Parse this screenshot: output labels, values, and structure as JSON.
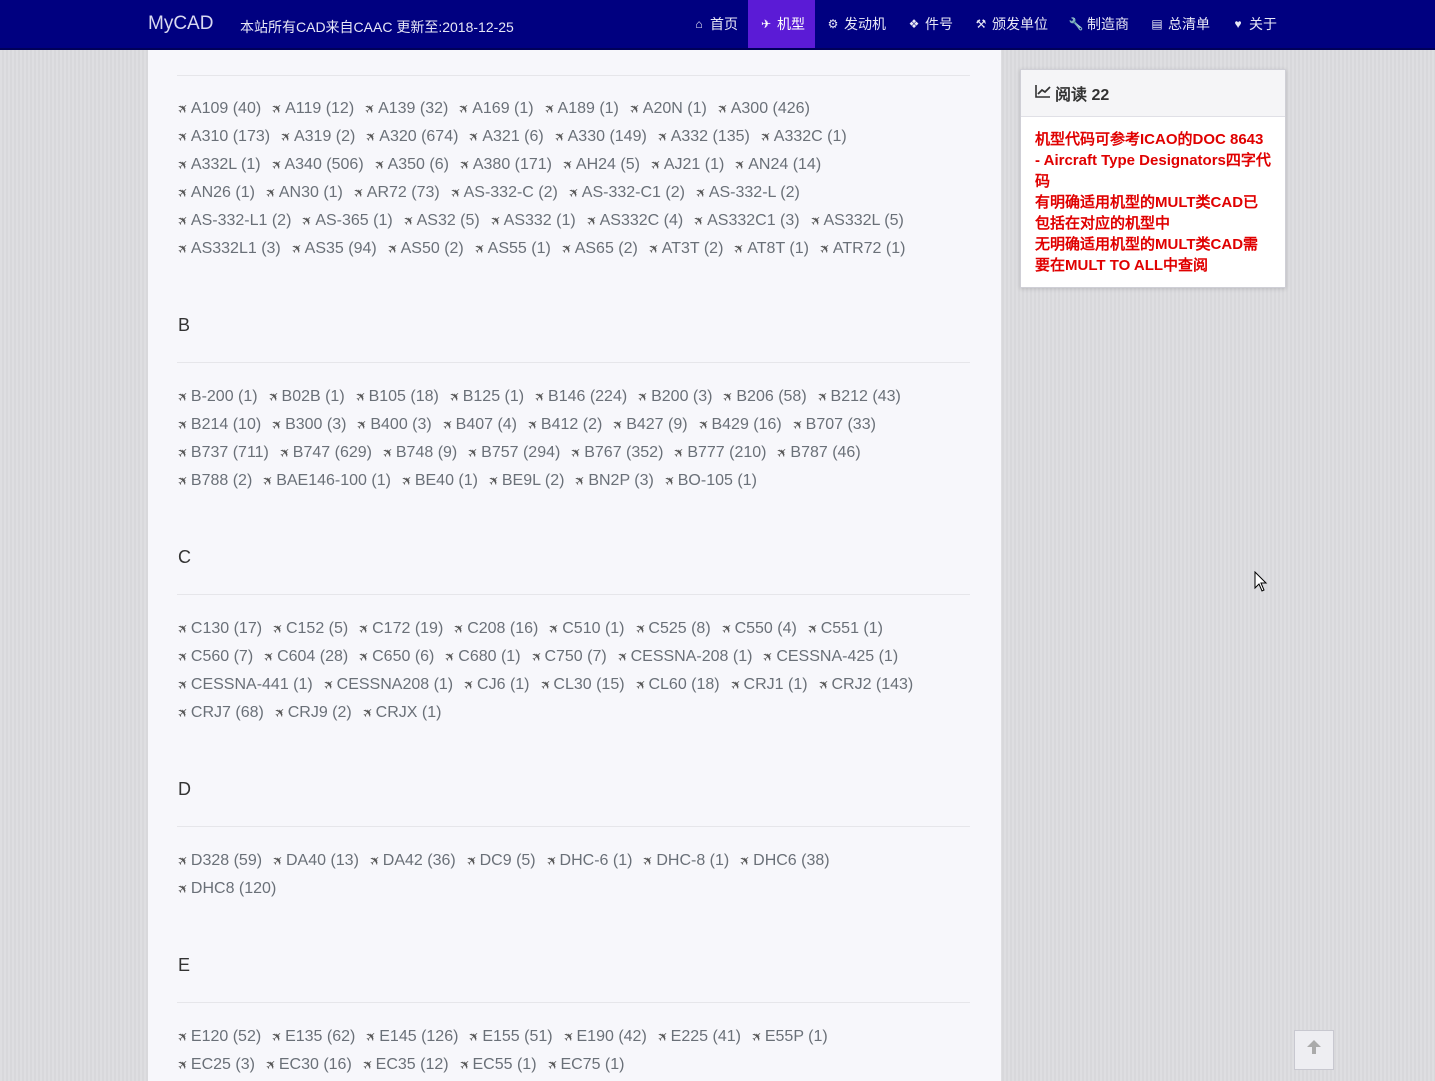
{
  "brand": "MyCAD",
  "subtitle": "本站所有CAD来自CAAC 更新至:2018-12-25",
  "nav": [
    {
      "label": "首页",
      "icon": "home-icon",
      "glyph": "⌂"
    },
    {
      "label": "机型",
      "icon": "plane-icon",
      "glyph": "✈"
    },
    {
      "label": "发动机",
      "icon": "cogs-icon",
      "glyph": "⚙"
    },
    {
      "label": "件号",
      "icon": "cubes-icon",
      "glyph": "❖"
    },
    {
      "label": "颁发单位",
      "icon": "gavel-icon",
      "glyph": "⚒"
    },
    {
      "label": "制造商",
      "icon": "wrench-icon",
      "glyph": "🔧"
    },
    {
      "label": "总清单",
      "icon": "list-icon",
      "glyph": "▤"
    },
    {
      "label": "关于",
      "icon": "heart-icon",
      "glyph": "♥"
    }
  ],
  "active_nav": 1,
  "sections": [
    {
      "letter": "",
      "rows": [
        [
          "A109 (40)",
          "A119 (12)",
          "A139 (32)",
          "A169 (1)",
          "A189 (1)",
          "A20N (1)",
          "A300 (426)"
        ],
        [
          "A310 (173)",
          "A319 (2)",
          "A320 (674)",
          "A321 (6)",
          "A330 (149)",
          "A332 (135)",
          "A332C (1)"
        ],
        [
          "A332L (1)",
          "A340 (506)",
          "A350 (6)",
          "A380 (171)",
          "AH24 (5)",
          "AJ21 (1)",
          "AN24 (14)"
        ],
        [
          "AN26 (1)",
          "AN30 (1)",
          "AR72 (73)",
          "AS-332-C (2)",
          "AS-332-C1 (2)",
          "AS-332-L (2)"
        ],
        [
          "AS-332-L1 (2)",
          "AS-365 (1)",
          "AS32 (5)",
          "AS332 (1)",
          "AS332C (4)",
          "AS332C1 (3)",
          "AS332L (5)"
        ],
        [
          "AS332L1 (3)",
          "AS35 (94)",
          "AS50 (2)",
          "AS55 (1)",
          "AS65 (2)",
          "AT3T (2)",
          "AT8T (1)",
          "ATR72 (1)"
        ]
      ]
    },
    {
      "letter": "B",
      "rows": [
        [
          "B-200 (1)",
          "B02B (1)",
          "B105 (18)",
          "B125 (1)",
          "B146 (224)",
          "B200 (3)",
          "B206 (58)",
          "B212 (43)"
        ],
        [
          "B214 (10)",
          "B300 (3)",
          "B400 (3)",
          "B407 (4)",
          "B412 (2)",
          "B427 (9)",
          "B429 (16)",
          "B707 (33)"
        ],
        [
          "B737 (711)",
          "B747 (629)",
          "B748 (9)",
          "B757 (294)",
          "B767 (352)",
          "B777 (210)",
          "B787 (46)"
        ],
        [
          "B788 (2)",
          "BAE146-100 (1)",
          "BE40 (1)",
          "BE9L (2)",
          "BN2P (3)",
          "BO-105 (1)"
        ]
      ]
    },
    {
      "letter": "C",
      "rows": [
        [
          "C130 (17)",
          "C152 (5)",
          "C172 (19)",
          "C208 (16)",
          "C510 (1)",
          "C525 (8)",
          "C550 (4)",
          "C551 (1)"
        ],
        [
          "C560 (7)",
          "C604 (28)",
          "C650 (6)",
          "C680 (1)",
          "C750 (7)",
          "CESSNA-208 (1)",
          "CESSNA-425 (1)"
        ],
        [
          "CESSNA-441 (1)",
          "CESSNA208 (1)",
          "CJ6 (1)",
          "CL30 (15)",
          "CL60 (18)",
          "CRJ1 (1)",
          "CRJ2 (143)"
        ],
        [
          "CRJ7 (68)",
          "CRJ9 (2)",
          "CRJX (1)"
        ]
      ]
    },
    {
      "letter": "D",
      "rows": [
        [
          "D328 (59)",
          "DA40 (13)",
          "DA42 (36)",
          "DC9 (5)",
          "DHC-6 (1)",
          "DHC-8 (1)",
          "DHC6 (38)"
        ],
        [
          "DHC8 (120)"
        ]
      ]
    },
    {
      "letter": "E",
      "rows": [
        [
          "E120 (52)",
          "E135 (62)",
          "E145 (126)",
          "E155 (51)",
          "E190 (42)",
          "E225 (41)",
          "E55P (1)"
        ],
        [
          "EC25 (3)",
          "EC30 (16)",
          "EC35 (12)",
          "EC55 (1)",
          "EC75 (1)"
        ]
      ]
    }
  ],
  "side": {
    "title": "阅读 22",
    "lines": [
      "机型代码可参考ICAO的DOC 8643 - Aircraft Type Designators四字代码",
      "有明确适用机型的MULT类CAD已包括在对应的机型中",
      "无明确适用机型的MULT类CAD需要在MULT TO ALL中查阅"
    ]
  }
}
